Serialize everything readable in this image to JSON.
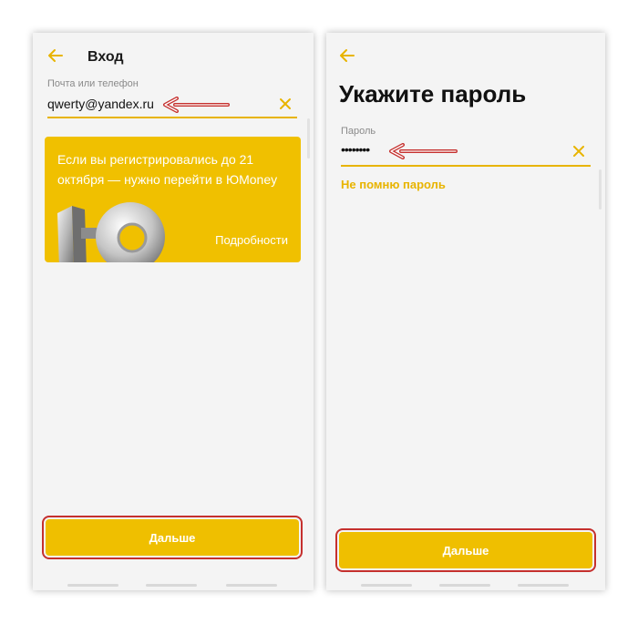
{
  "login_screen": {
    "title": "Вход",
    "field_label": "Почта или телефон",
    "field_value": "qwerty@yandex.ru",
    "promo": {
      "text": "Если вы регистрировались до 21 октября — нужно перейти в ЮMoney",
      "link": "Подробности"
    },
    "next_button": "Дальше"
  },
  "password_screen": {
    "title": "Укажите пароль",
    "field_label": "Пароль",
    "field_value": "••••••••",
    "forgot_link": "Не помню пароль",
    "next_button": "Дальше"
  },
  "colors": {
    "accent": "#f0c000",
    "annotation": "#c5302e",
    "background": "#f4f4f4"
  }
}
